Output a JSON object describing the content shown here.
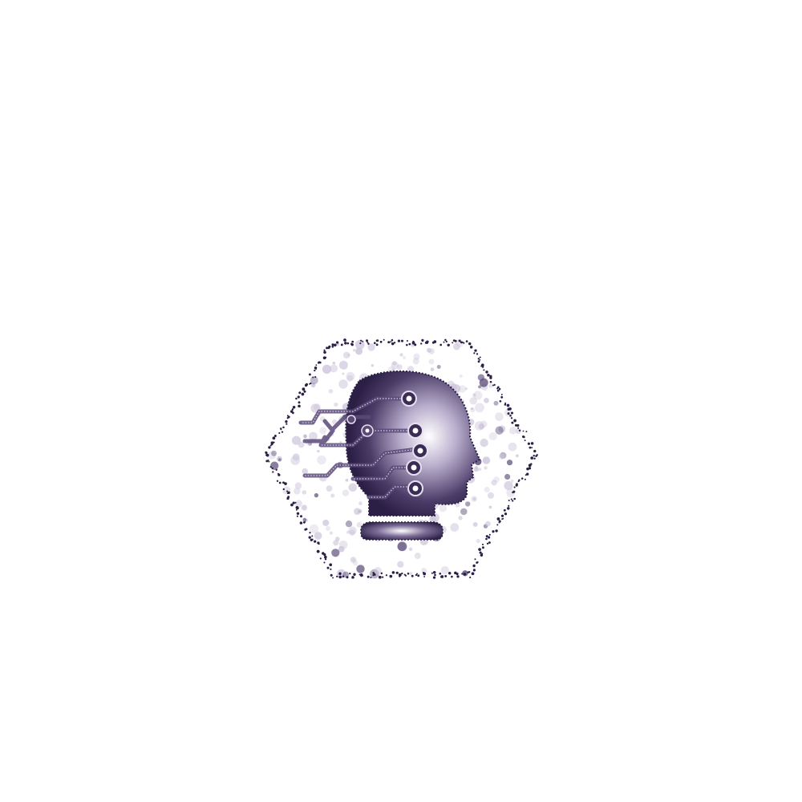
{
  "artwork": {
    "subject": "ai-head-icon",
    "frame_shape": "hexagon",
    "style": "dotted-particles",
    "colors": {
      "dark": "#2b1f45",
      "mid": "#5a4a78",
      "light": "#cfc7dc",
      "highlight": "#ffffff",
      "background": "#ffffff"
    }
  }
}
